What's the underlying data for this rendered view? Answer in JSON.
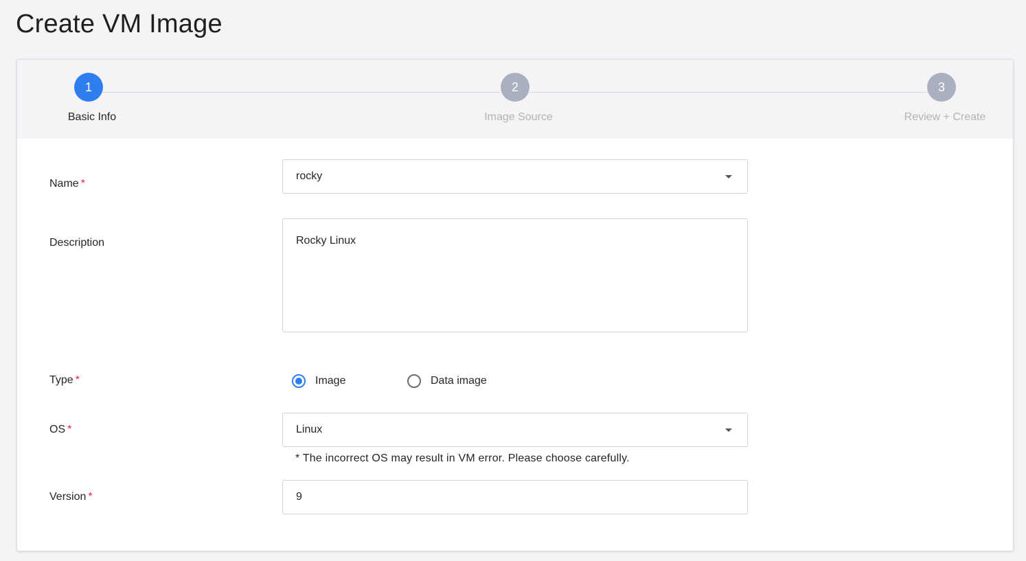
{
  "page": {
    "title": "Create VM Image"
  },
  "steps": [
    {
      "number": "1",
      "label": "Basic Info",
      "active": true
    },
    {
      "number": "2",
      "label": "Image Source",
      "active": false
    },
    {
      "number": "3",
      "label": "Review + Create",
      "active": false
    }
  ],
  "form": {
    "name": {
      "label": "Name",
      "required_mark": "*",
      "value": "rocky"
    },
    "description": {
      "label": "Description",
      "value": "Rocky Linux"
    },
    "type": {
      "label": "Type",
      "required_mark": "*",
      "options": [
        {
          "label": "Image",
          "selected": true
        },
        {
          "label": "Data image",
          "selected": false
        }
      ]
    },
    "os": {
      "label": "OS",
      "required_mark": "*",
      "value": "Linux",
      "hint": "* The incorrect OS may result in VM error. Please choose carefully."
    },
    "version": {
      "label": "Version",
      "required_mark": "*",
      "value": "9"
    }
  },
  "colors": {
    "accent": "#2f7ef0",
    "required": "#e0245e",
    "step_inactive": "#aab0bf",
    "background": "#f4f4f6"
  }
}
